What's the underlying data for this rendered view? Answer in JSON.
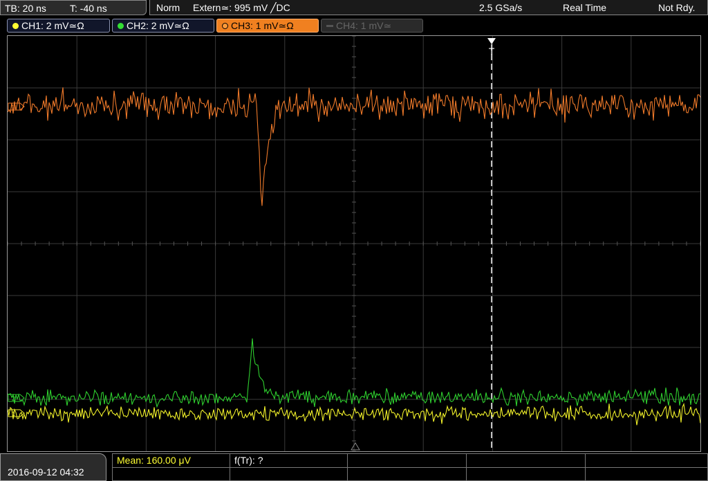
{
  "status": {
    "timebase": "TB: 20 ns",
    "trigger_offset": "T: -40 ns",
    "trigger_mode": "Norm",
    "trigger_source": "Extern≃: 995 mV ╱DC",
    "sample_rate": "2.5 GSa/s",
    "acq_mode": "Real Time",
    "state": "Not Rdy."
  },
  "channels": [
    {
      "label": "CH1: 2 mV≃Ω",
      "color": "#ffff33"
    },
    {
      "label": "CH2: 2 mV≃Ω",
      "color": "#33dd33"
    },
    {
      "label": "CH3: 1 mV≃Ω",
      "color": "#f08020"
    },
    {
      "label": "CH4: 1 mV≃",
      "color": "#666666"
    }
  ],
  "screen": {
    "trigger_marker": "T",
    "ch3_marker": "3",
    "ch2_marker": "2",
    "ch1_marker": "1"
  },
  "bottom": {
    "datetime": "2016-09-12 04:32",
    "measurements": [
      {
        "label": "Mean: 160.00 μV",
        "color": "#ffff33"
      },
      {
        "label": "f(Tr): ?",
        "color": "#ffffff"
      }
    ]
  }
}
